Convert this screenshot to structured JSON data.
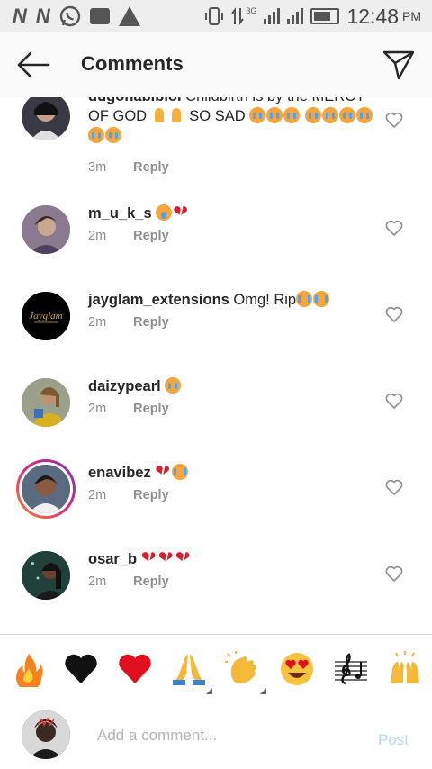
{
  "status_bar": {
    "left_icons": [
      "n-notification-icon",
      "n-notification-icon",
      "whatsapp-icon",
      "image-icon",
      "warning-icon"
    ],
    "network": "3G",
    "time": "12:48",
    "ampm": "PM"
  },
  "header": {
    "title": "Comments"
  },
  "comments": [
    {
      "username": "dugonabibiol",
      "text": " Childbirth is by the MERCY OF GOD",
      "text2": " SO SAD",
      "time": "3m",
      "reply": "Reply",
      "avatar_color": "#3a3a44"
    },
    {
      "username": "m_u_k_s",
      "text": " ",
      "time": "2m",
      "reply": "Reply",
      "avatar_color": "#6b5a7a"
    },
    {
      "username": "jayglam_extensions",
      "text": " Omg! Rip",
      "time": "2m",
      "reply": "Reply",
      "avatar_color": "#000000",
      "avatar_label": "Jayglam"
    },
    {
      "username": "daizypearl",
      "text": " ",
      "time": "2m",
      "reply": "Reply",
      "avatar_color": "#8a8a70"
    },
    {
      "username": "enavibez",
      "text": " ",
      "time": "2m",
      "reply": "Reply",
      "avatar_color": "#7a5040"
    },
    {
      "username": "osar_b",
      "text": " ",
      "time": "2m",
      "reply": "Reply",
      "avatar_color": "#2a4a44"
    }
  ],
  "emoji_bar": [
    "fire",
    "black-heart",
    "red-heart",
    "folded-hands",
    "clapping-hands",
    "heart-eyes",
    "music-score",
    "raising-hands"
  ],
  "composer": {
    "placeholder": "Add a comment...",
    "post_label": "Post"
  },
  "colors": {
    "accent_post": "#b3dbff",
    "meta_gray": "#8e8e8e",
    "story_ring_start": "#f58529",
    "story_ring_end": "#c13584"
  }
}
